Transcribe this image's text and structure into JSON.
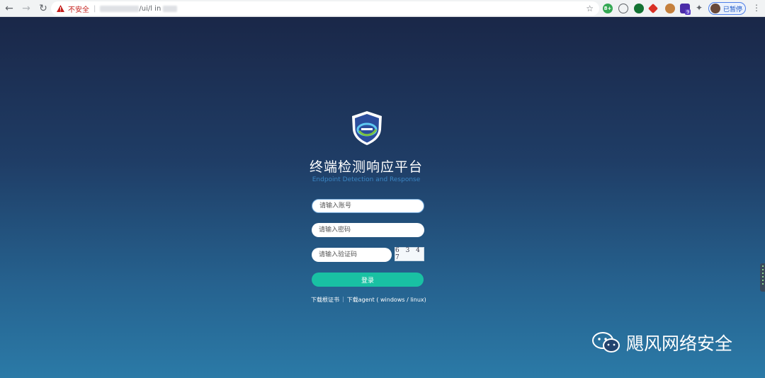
{
  "browser": {
    "security_label": "不安全",
    "url_visible_fragment": "/ui/l   in",
    "profile_label": "已暂停",
    "extension_badge": "9",
    "extension_a_label": "8+"
  },
  "page": {
    "title_cn": "终端检测响应平台",
    "title_en": "Endpoint Detection and Response",
    "account_placeholder": "请输入账号",
    "password_placeholder": "请输入密码",
    "captcha_placeholder": "请输入验证码",
    "captcha_text": "6 3 4 7",
    "login_label": "登录",
    "link_cert": "下载根证书",
    "link_sep": "|",
    "link_agent": "下载agent ( windows / linux)"
  },
  "watermark": {
    "text": "飓风网络安全"
  },
  "colors": {
    "login_button": "#19c1a3",
    "background_top": "#1a2748",
    "background_bottom": "#2b7aa7",
    "subtitle": "#3b86c4"
  },
  "icons": [
    "back-icon",
    "forward-icon",
    "reload-icon",
    "warning-icon",
    "star-icon",
    "puzzle-icon",
    "menu-icon",
    "shield-logo-icon",
    "wechat-icon"
  ]
}
